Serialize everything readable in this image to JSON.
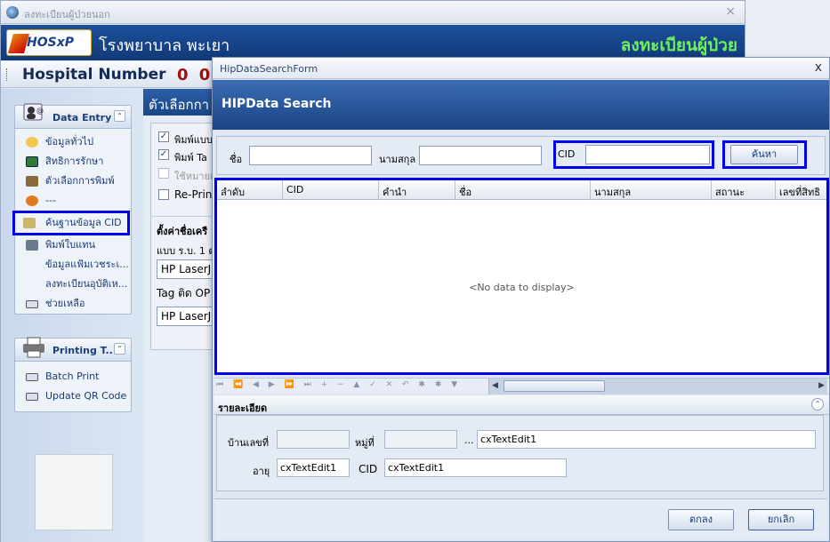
{
  "bg_window": {
    "title": "ลงทะเบียนผู้ป่วยนอก",
    "close": "×",
    "hospital_name": "โรงพยาบาล พะเยา",
    "logo_text": "HOSxP",
    "register_title": "ลงทะเบียนผู้ป่วย",
    "hn_label": "Hospital Number",
    "hn_value": "0 0"
  },
  "sidebar": {
    "data_entry_title": "Data Entry",
    "items": [
      {
        "label": "ข้อมูลทั่วไป",
        "icon": "info-icon"
      },
      {
        "label": "สิทธิการรักษา",
        "icon": "card-icon"
      },
      {
        "label": "ตัวเลือกการพิมพ์",
        "icon": "printer-icon"
      },
      {
        "label": "---",
        "icon": "users-icon"
      },
      {
        "label": "ค้นฐานข้อมูล CID",
        "icon": "search-db-icon"
      },
      {
        "label": "พิมพ์ใบแทน",
        "icon": "printer-icon"
      },
      {
        "label": "ข้อมูลแฟ้มเวชระเ...",
        "icon": ""
      },
      {
        "label": "ลงทะเบียนอุบัติเห...",
        "icon": ""
      },
      {
        "label": "ช่วยเหลือ",
        "icon": "help-icon"
      }
    ],
    "printing_title": "Printing T...",
    "printing_items": [
      {
        "label": "Batch Print",
        "icon": "print-batch-icon"
      },
      {
        "label": "Update QR Code",
        "icon": "qr-icon"
      }
    ]
  },
  "options_panel": {
    "header": "ตัวเลือกกา",
    "check1": "พิมพ์แบบ",
    "check2": "พิมพ์ Ta",
    "check3": "ใช้หมายเ",
    "check4": "Re-Prin",
    "printer_section": "ตั้งค่าชื่อเครื",
    "label_a": "แบบ ร.บ. 1 ต",
    "printer_a": "HP LaserJ",
    "label_b": "Tag ติด OP",
    "printer_b": "HP LaserJ"
  },
  "dialog": {
    "title": "HipDataSearchForm",
    "close": "x",
    "header": "HIPData Search",
    "search": {
      "first_name_label": "ชื่อ",
      "last_name_label": "นามสกุล",
      "cid_label": "CID",
      "first_name_value": "",
      "last_name_value": "",
      "cid_value": "",
      "search_button": "ค้นหา"
    },
    "grid": {
      "columns": [
        "ลำดับ",
        "CID",
        "คำนำ",
        "ชื่อ",
        "นามสกุล",
        "สถานะ",
        "เลขที่สิทธิ"
      ],
      "empty_text": "<No data to display>",
      "nav_glyphs": "⏮ ⏪ ◀ ▶ ⏩ ⏭ + − ▲ ✓ ✕ ↶ ✱ ✱ ▼"
    },
    "details": {
      "title": "รายละเอียด",
      "house_no_label": "บ้านเลขที่",
      "house_no_value": "",
      "moo_label": "หมู่ที่",
      "moo_value": "",
      "ellipsis": "...",
      "address_value": "cxTextEdit1",
      "age_label": "อายุ",
      "age_value": "cxTextEdit1",
      "cid_label": "CID",
      "cid_value": "cxTextEdit1"
    },
    "ok_button": "ตกลง",
    "cancel_button": "ยกเลิก"
  },
  "colors": {
    "highlight": "#0000ee",
    "banner": "#1d4f9c",
    "title_green": "#6ef05a"
  }
}
